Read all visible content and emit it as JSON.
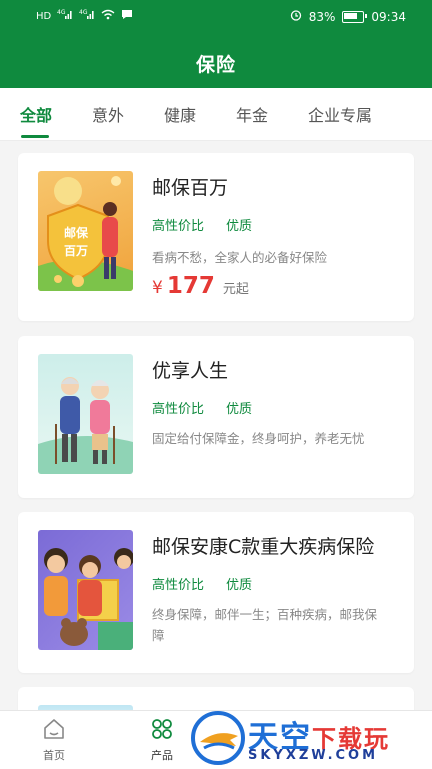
{
  "status": {
    "left": [
      "HD",
      "4G",
      "4G"
    ],
    "battery": "83%",
    "time": "09:34"
  },
  "header": {
    "title": "保险"
  },
  "tabs": [
    {
      "label": "全部",
      "active": true
    },
    {
      "label": "意外",
      "active": false
    },
    {
      "label": "健康",
      "active": false
    },
    {
      "label": "年金",
      "active": false
    },
    {
      "label": "企业专属",
      "active": false
    }
  ],
  "products": [
    {
      "title": "邮保百万",
      "tags": [
        "高性价比",
        "优质"
      ],
      "desc": "看病不愁，全家人的必备好保险",
      "price_symbol": "¥",
      "price": "177",
      "price_unit": "元起",
      "thumb_text": [
        "邮保",
        "百万"
      ]
    },
    {
      "title": "优享人生",
      "tags": [
        "高性价比",
        "优质"
      ],
      "desc": "固定给付保障金，终身呵护，养老无忧"
    },
    {
      "title": "邮保安康C款重大疾病保险",
      "tags": [
        "高性价比",
        "优质"
      ],
      "desc": "终身保障，邮伴一生；百种疾病，邮我保障"
    }
  ],
  "nav": [
    {
      "label": "首页",
      "icon": "home-icon"
    },
    {
      "label": "产品",
      "icon": "grid-icon"
    }
  ],
  "watermark": {
    "main": "天空",
    "accent": "下载玩",
    "sub": "SKYXZW.COM"
  },
  "colors": {
    "brand": "#0f8a3e",
    "price": "#e53935"
  }
}
